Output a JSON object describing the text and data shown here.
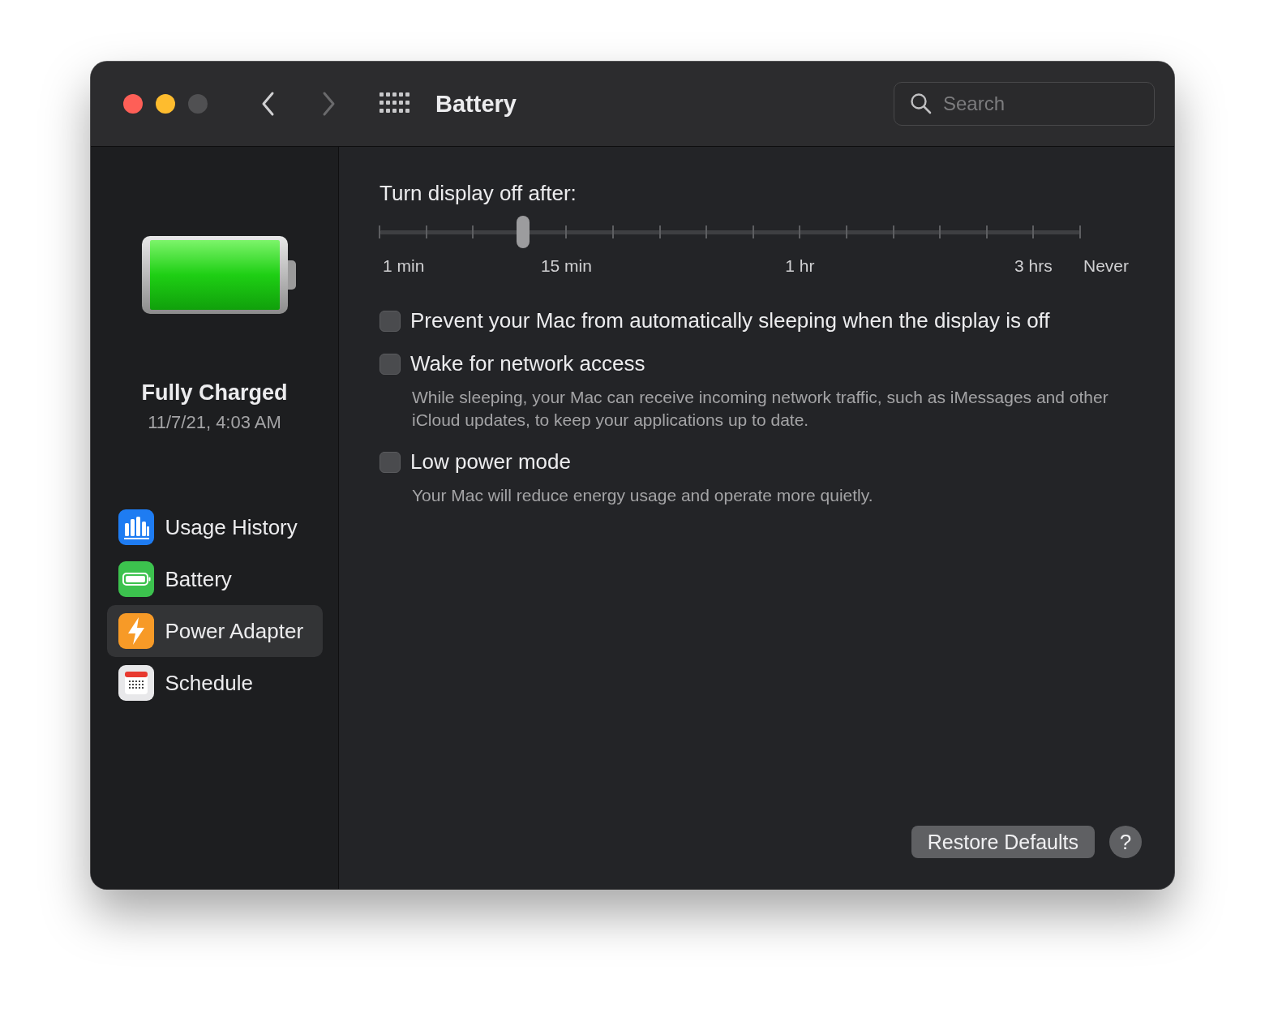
{
  "window": {
    "title": "Battery"
  },
  "search": {
    "placeholder": "Search"
  },
  "status": {
    "title": "Fully Charged",
    "time": "11/7/21, 4:03 AM"
  },
  "sidebar": {
    "items": [
      {
        "label": "Usage History",
        "kind": "chart",
        "selected": false
      },
      {
        "label": "Battery",
        "kind": "battery",
        "selected": false
      },
      {
        "label": "Power Adapter",
        "kind": "bolt",
        "selected": true
      },
      {
        "label": "Schedule",
        "kind": "calendar",
        "selected": false
      }
    ]
  },
  "display_slider": {
    "label": "Turn display off after:",
    "level": 0.205,
    "marks": [
      "1 min",
      "15 min",
      "1 hr",
      "3 hrs",
      "Never"
    ]
  },
  "options": [
    {
      "label": "Prevent your Mac from automatically sleeping when the display is off",
      "checked": false
    },
    {
      "label": "Wake for network access",
      "checked": false,
      "description": "While sleeping, your Mac can receive incoming network traffic, such as iMessages and other iCloud updates, to keep your applications up to date."
    },
    {
      "label": "Low power mode",
      "checked": false,
      "description": "Your Mac will reduce energy usage and operate more quietly."
    }
  ],
  "buttons": {
    "restore": "Restore Defaults",
    "help": "?"
  }
}
